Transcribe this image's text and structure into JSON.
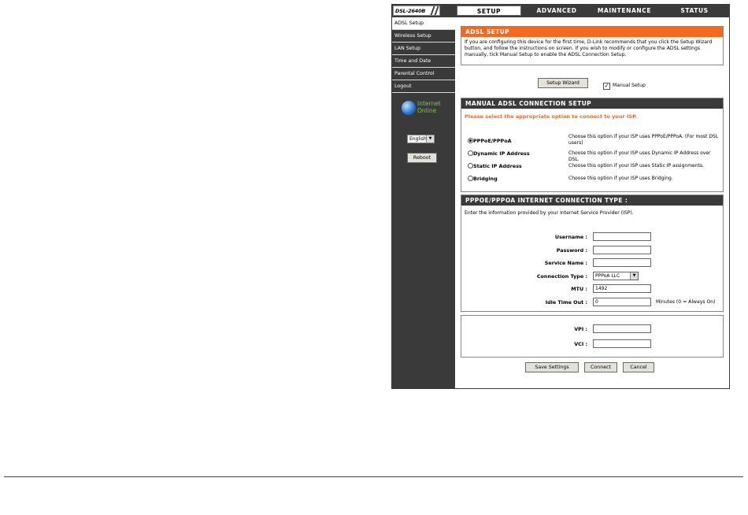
{
  "header": {
    "model": "DSL-2640B",
    "tabs": [
      {
        "label": "SETUP",
        "active": true
      },
      {
        "label": "ADVANCED",
        "active": false
      },
      {
        "label": "MAINTENANCE",
        "active": false
      },
      {
        "label": "STATUS",
        "active": false
      }
    ]
  },
  "sidebar": {
    "items": [
      {
        "label": "ADSL Setup",
        "active": true
      },
      {
        "label": "Wireless Setup",
        "active": false
      },
      {
        "label": "LAN Setup",
        "active": false
      },
      {
        "label": "Time and Date",
        "active": false
      },
      {
        "label": "Parental Control",
        "active": false
      },
      {
        "label": "Logout",
        "active": false
      }
    ],
    "status_line1": "Internet",
    "status_line2": "Online",
    "language": "English",
    "reboot_label": "Reboot"
  },
  "adsl_setup": {
    "title": "ADSL SETUP",
    "description": "If you are configuring this device for the first time, D-Link recommends that you click the Setup Wizard button, and follow the instructions on screen. If you wish to modify or configure the ADSL settings manually, tick Manual Setup to enable the ADSL Connection Setup.",
    "wizard_label": "Setup Wizard",
    "manual_label": "Manual Setup",
    "manual_checked": true
  },
  "manual": {
    "title": "MANUAL ADSL CONNECTION SETUP",
    "prompt": "Please select the appropriate option to connect to your ISP.",
    "options": [
      {
        "label": "PPPoE/PPPoA",
        "desc": "Choose this option if your ISP uses PPPoE/PPPoA. (For most DSL users)",
        "selected": true
      },
      {
        "label": "Dynamic IP Address",
        "desc": "Choose this option if your ISP uses Dynamic IP Address over DSL.",
        "selected": false
      },
      {
        "label": "Static IP Address",
        "desc": "Choose this option if your ISP uses Static IP assignments.",
        "selected": false
      },
      {
        "label": "Bridging",
        "desc": "Choose this option if your ISP uses Bridging.",
        "selected": false
      }
    ]
  },
  "pppoe": {
    "title": "PPPOE/PPPOA INTERNET CONNECTION TYPE :",
    "intro": "Enter the information provided by your Internet Service Provider (ISP).",
    "username_label": "Username :",
    "username_value": "",
    "password_label": "Password :",
    "password_value": "",
    "service_label": "Service Name :",
    "service_value": "",
    "conn_type_label": "Connection Type :",
    "conn_type_value": "PPPoA LLC",
    "mtu_label": "MTU :",
    "mtu_value": "1492",
    "idle_label": "Idle Time Out :",
    "idle_value": "0",
    "idle_note": "Minutes (0 = Always On)"
  },
  "vc": {
    "vpi_label": "VPI :",
    "vpi_value": "",
    "vci_label": "VCI :",
    "vci_value": ""
  },
  "footer_buttons": {
    "save": "Save Settings",
    "connect": "Connect",
    "cancel": "Cancel"
  }
}
